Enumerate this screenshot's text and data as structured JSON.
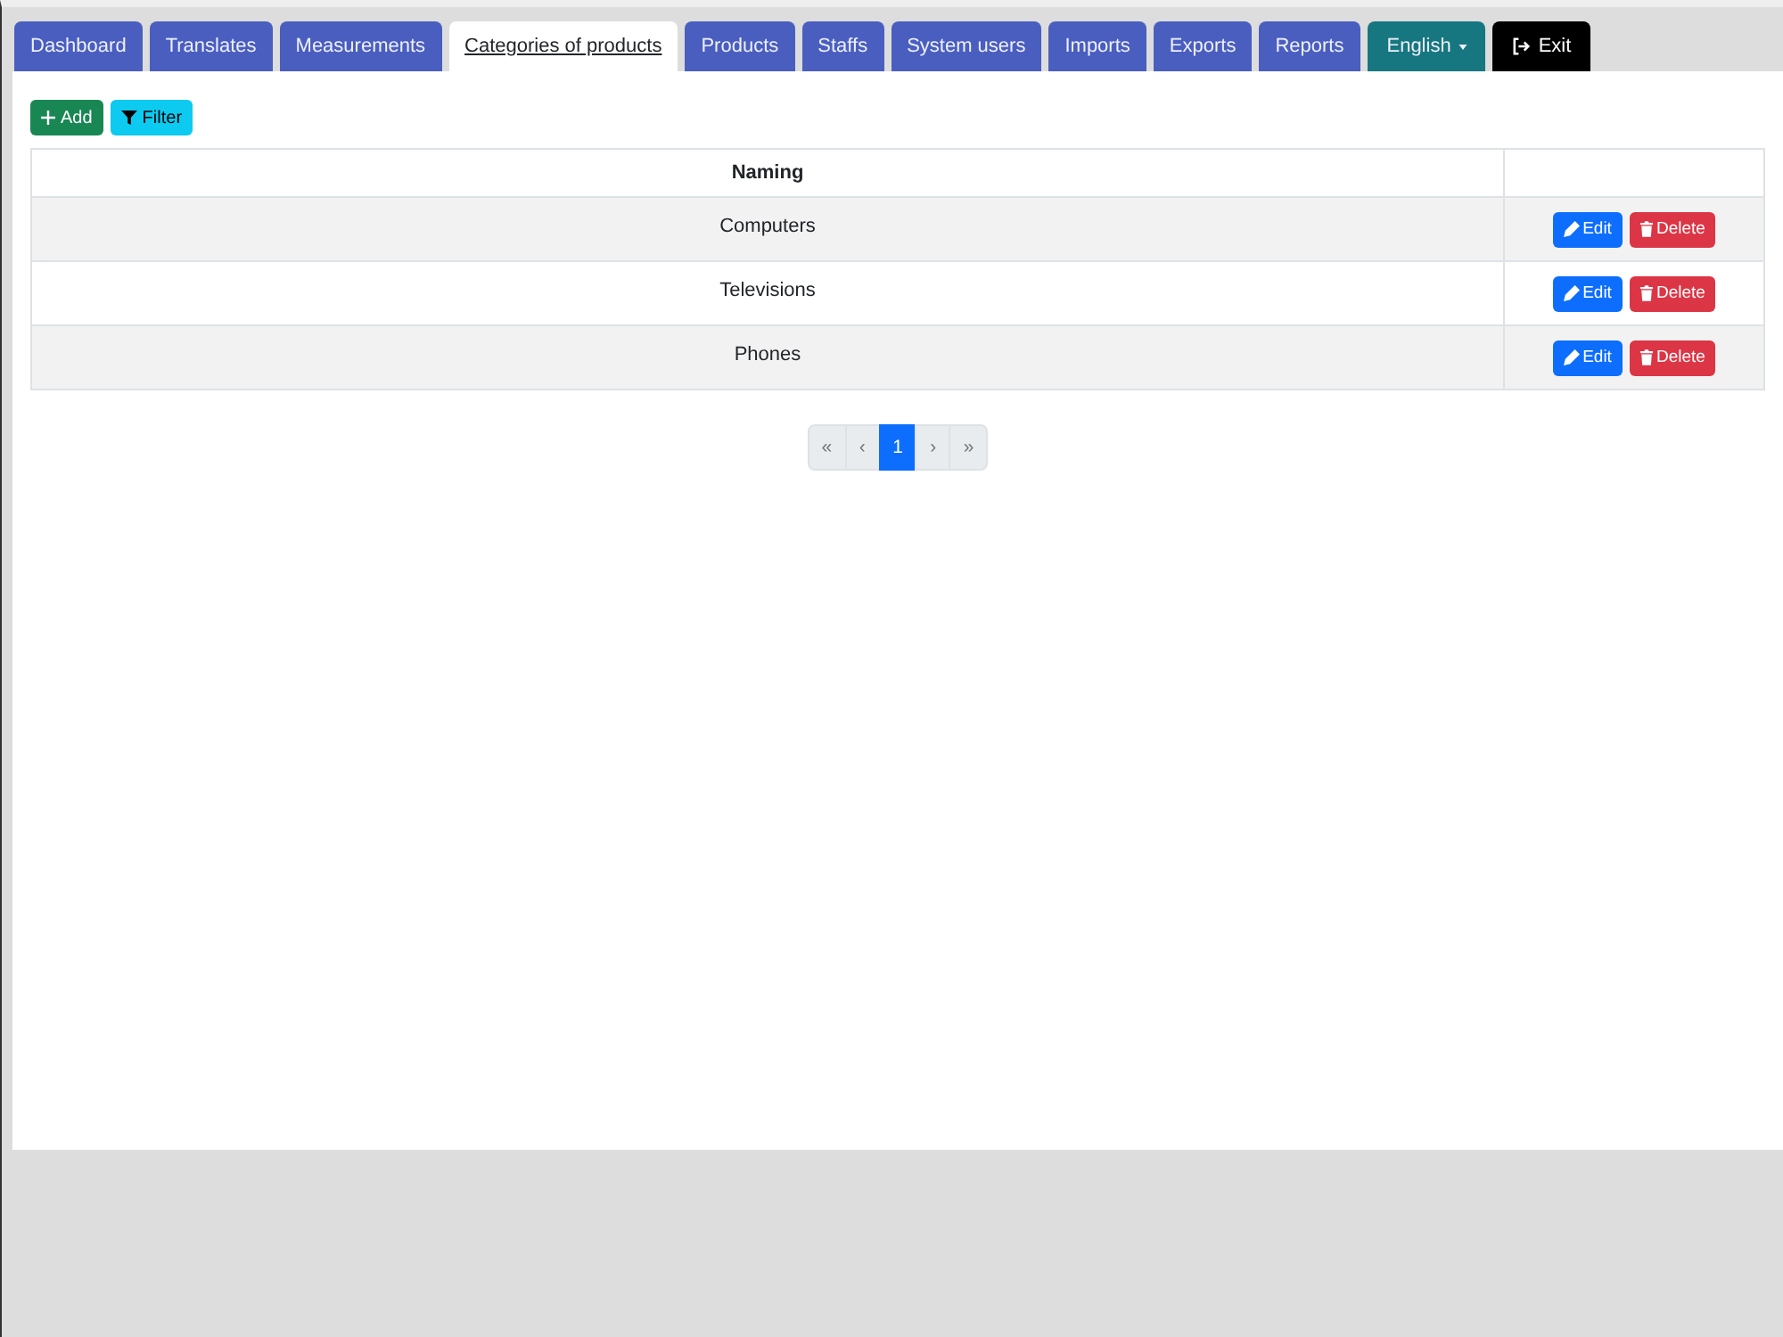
{
  "tabs": [
    {
      "label": "Dashboard",
      "kind": "nav",
      "selected": false
    },
    {
      "label": "Translates",
      "kind": "nav",
      "selected": false
    },
    {
      "label": "Measurements",
      "kind": "nav",
      "selected": false
    },
    {
      "label": "Categories of products",
      "kind": "nav",
      "selected": true
    },
    {
      "label": "Products",
      "kind": "nav",
      "selected": false
    },
    {
      "label": "Staffs",
      "kind": "nav",
      "selected": false
    },
    {
      "label": "System users",
      "kind": "nav",
      "selected": false
    },
    {
      "label": "Imports",
      "kind": "nav",
      "selected": false
    },
    {
      "label": "Exports",
      "kind": "nav",
      "selected": false
    },
    {
      "label": "Reports",
      "kind": "nav",
      "selected": false
    },
    {
      "label": "English",
      "kind": "dropdown",
      "selected": false
    },
    {
      "label": "Exit",
      "kind": "exit",
      "selected": false
    }
  ],
  "toolbar": [
    {
      "label": "Add",
      "kind": "add"
    },
    {
      "label": "Filter",
      "kind": "filter"
    }
  ],
  "table": {
    "columns": [
      "Naming"
    ],
    "rows": [
      {
        "naming": "Computers",
        "actions": [
          {
            "label": "Edit",
            "kind": "edit"
          },
          {
            "label": "Delete",
            "kind": "delete"
          }
        ]
      },
      {
        "naming": "Televisions",
        "actions": [
          {
            "label": "Edit",
            "kind": "edit"
          },
          {
            "label": "Delete",
            "kind": "delete"
          }
        ]
      },
      {
        "naming": "Phones",
        "actions": [
          {
            "label": "Edit",
            "kind": "edit"
          },
          {
            "label": "Delete",
            "kind": "delete"
          }
        ]
      }
    ]
  },
  "pagination": [
    {
      "label": "«",
      "selected": false,
      "disabled": true
    },
    {
      "label": "‹",
      "selected": false,
      "disabled": true
    },
    {
      "label": "1",
      "selected": true,
      "disabled": false
    },
    {
      "label": "›",
      "selected": false,
      "disabled": true
    },
    {
      "label": "»",
      "selected": false,
      "disabled": true
    }
  ]
}
